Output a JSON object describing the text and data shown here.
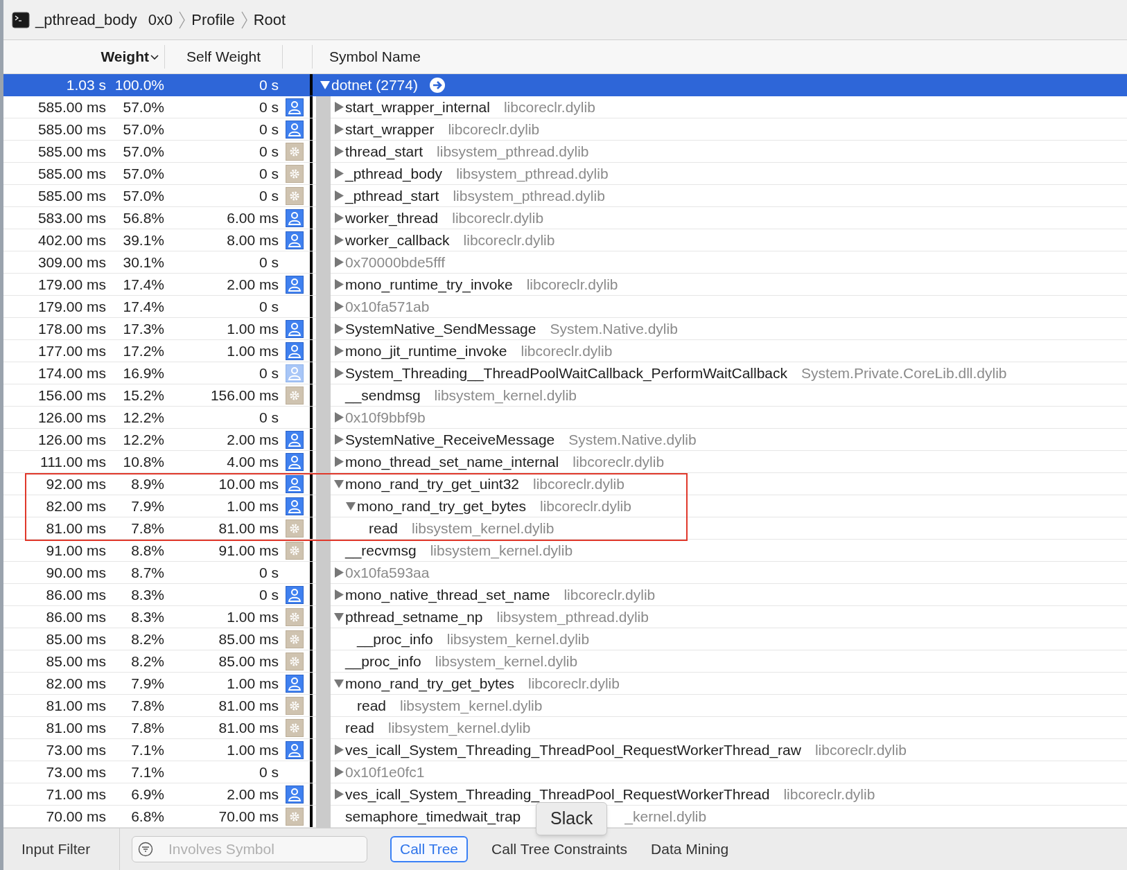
{
  "breadcrumb": [
    {
      "label": "_pthread_body",
      "detail": "0x0"
    },
    {
      "label": "Profile"
    },
    {
      "label": "Root"
    }
  ],
  "columns": [
    {
      "label": "Weight",
      "sorted": true
    },
    {
      "label": "Self Weight",
      "sorted": false
    },
    {
      "label": "Symbol Name",
      "sorted": false
    }
  ],
  "tree": [
    {
      "weight": "1.03 s",
      "percent": "100.0%",
      "self_weight": "0 s",
      "name": "dotnet (2774)",
      "kind": "process",
      "expanded": true,
      "selected": true,
      "children": [
        {
          "weight": "585.00 ms",
          "percent": "57.0%",
          "self_weight": "0 s",
          "name": "start_wrapper_internal",
          "library": "libcoreclr.dylib",
          "kind": "user",
          "expanded": false,
          "selected": false
        },
        {
          "weight": "585.00 ms",
          "percent": "57.0%",
          "self_weight": "0 s",
          "name": "start_wrapper",
          "library": "libcoreclr.dylib",
          "kind": "user",
          "expanded": false,
          "selected": false
        },
        {
          "weight": "585.00 ms",
          "percent": "57.0%",
          "self_weight": "0 s",
          "name": "thread_start",
          "library": "libsystem_pthread.dylib",
          "kind": "system",
          "expanded": false,
          "selected": false
        },
        {
          "weight": "585.00 ms",
          "percent": "57.0%",
          "self_weight": "0 s",
          "name": "_pthread_body",
          "library": "libsystem_pthread.dylib",
          "kind": "system",
          "expanded": false,
          "selected": false
        },
        {
          "weight": "585.00 ms",
          "percent": "57.0%",
          "self_weight": "0 s",
          "name": "_pthread_start",
          "library": "libsystem_pthread.dylib",
          "kind": "system",
          "expanded": false,
          "selected": false
        },
        {
          "weight": "583.00 ms",
          "percent": "56.8%",
          "self_weight": "6.00 ms",
          "name": "worker_thread",
          "library": "libcoreclr.dylib",
          "kind": "user",
          "expanded": false,
          "selected": false
        },
        {
          "weight": "402.00 ms",
          "percent": "39.1%",
          "self_weight": "8.00 ms",
          "name": "worker_callback",
          "library": "libcoreclr.dylib",
          "kind": "user",
          "expanded": false,
          "selected": false
        },
        {
          "weight": "309.00 ms",
          "percent": "30.1%",
          "self_weight": "0 s",
          "name": "0x70000bde5fff",
          "kind": "address",
          "expanded": false,
          "selected": false
        },
        {
          "weight": "179.00 ms",
          "percent": "17.4%",
          "self_weight": "2.00 ms",
          "name": "mono_runtime_try_invoke",
          "library": "libcoreclr.dylib",
          "kind": "user",
          "expanded": false,
          "selected": false
        },
        {
          "weight": "179.00 ms",
          "percent": "17.4%",
          "self_weight": "0 s",
          "name": "0x10fa571ab",
          "kind": "address",
          "expanded": false,
          "selected": false
        },
        {
          "weight": "178.00 ms",
          "percent": "17.3%",
          "self_weight": "1.00 ms",
          "name": "SystemNative_SendMessage",
          "library": "System.Native.dylib",
          "kind": "user",
          "expanded": false,
          "selected": false
        },
        {
          "weight": "177.00 ms",
          "percent": "17.2%",
          "self_weight": "1.00 ms",
          "name": "mono_jit_runtime_invoke",
          "library": "libcoreclr.dylib",
          "kind": "user",
          "expanded": false,
          "selected": false
        },
        {
          "weight": "174.00 ms",
          "percent": "16.9%",
          "self_weight": "0 s",
          "name": "System_Threading__ThreadPoolWaitCallback_PerformWaitCallback",
          "library": "System.Private.CoreLib.dll.dylib",
          "kind": "user_dim",
          "expanded": false,
          "selected": false
        },
        {
          "weight": "156.00 ms",
          "percent": "15.2%",
          "self_weight": "156.00 ms",
          "name": "__sendmsg",
          "library": "libsystem_kernel.dylib",
          "kind": "system",
          "selected": false
        },
        {
          "weight": "126.00 ms",
          "percent": "12.2%",
          "self_weight": "0 s",
          "name": "0x10f9bbf9b",
          "kind": "address",
          "expanded": false,
          "selected": false
        },
        {
          "weight": "126.00 ms",
          "percent": "12.2%",
          "self_weight": "2.00 ms",
          "name": "SystemNative_ReceiveMessage",
          "library": "System.Native.dylib",
          "kind": "user",
          "expanded": false,
          "selected": false
        },
        {
          "weight": "111.00 ms",
          "percent": "10.8%",
          "self_weight": "4.00 ms",
          "name": "mono_thread_set_name_internal",
          "library": "libcoreclr.dylib",
          "kind": "user",
          "expanded": false,
          "selected": false
        },
        {
          "weight": "92.00 ms",
          "percent": "8.9%",
          "self_weight": "10.00 ms",
          "name": "mono_rand_try_get_uint32",
          "library": "libcoreclr.dylib",
          "kind": "user",
          "expanded": true,
          "selected": false,
          "boxed": true,
          "children": [
            {
              "weight": "82.00 ms",
              "percent": "7.9%",
              "self_weight": "1.00 ms",
              "name": "mono_rand_try_get_bytes",
              "library": "libcoreclr.dylib",
              "kind": "user",
              "expanded": true,
              "selected": false,
              "boxed": true,
              "children": [
                {
                  "weight": "81.00 ms",
                  "percent": "7.8%",
                  "self_weight": "81.00 ms",
                  "name": "read",
                  "library": "libsystem_kernel.dylib",
                  "kind": "system",
                  "selected": false,
                  "boxed": true
                }
              ]
            }
          ]
        },
        {
          "weight": "91.00 ms",
          "percent": "8.8%",
          "self_weight": "91.00 ms",
          "name": "__recvmsg",
          "library": "libsystem_kernel.dylib",
          "kind": "system",
          "selected": false
        },
        {
          "weight": "90.00 ms",
          "percent": "8.7%",
          "self_weight": "0 s",
          "name": "0x10fa593aa",
          "kind": "address",
          "expanded": false,
          "selected": false
        },
        {
          "weight": "86.00 ms",
          "percent": "8.3%",
          "self_weight": "0 s",
          "name": "mono_native_thread_set_name",
          "library": "libcoreclr.dylib",
          "kind": "user",
          "expanded": false,
          "selected": false
        },
        {
          "weight": "86.00 ms",
          "percent": "8.3%",
          "self_weight": "1.00 ms",
          "name": "pthread_setname_np",
          "library": "libsystem_pthread.dylib",
          "kind": "system",
          "expanded": true,
          "selected": false,
          "children": [
            {
              "weight": "85.00 ms",
              "percent": "8.2%",
              "self_weight": "85.00 ms",
              "name": "__proc_info",
              "library": "libsystem_kernel.dylib",
              "kind": "system",
              "selected": false
            }
          ]
        },
        {
          "weight": "85.00 ms",
          "percent": "8.2%",
          "self_weight": "85.00 ms",
          "name": "__proc_info",
          "library": "libsystem_kernel.dylib",
          "kind": "system",
          "selected": false
        },
        {
          "weight": "82.00 ms",
          "percent": "7.9%",
          "self_weight": "1.00 ms",
          "name": "mono_rand_try_get_bytes",
          "library": "libcoreclr.dylib",
          "kind": "user",
          "expanded": true,
          "selected": false,
          "children": [
            {
              "weight": "81.00 ms",
              "percent": "7.8%",
              "self_weight": "81.00 ms",
              "name": "read",
              "library": "libsystem_kernel.dylib",
              "kind": "system",
              "selected": false
            }
          ]
        },
        {
          "weight": "81.00 ms",
          "percent": "7.8%",
          "self_weight": "81.00 ms",
          "name": "read",
          "library": "libsystem_kernel.dylib",
          "kind": "system",
          "selected": false
        },
        {
          "weight": "73.00 ms",
          "percent": "7.1%",
          "self_weight": "1.00 ms",
          "name": "ves_icall_System_Threading_ThreadPool_RequestWorkerThread_raw",
          "library": "libcoreclr.dylib",
          "kind": "user",
          "expanded": false,
          "selected": false
        },
        {
          "weight": "73.00 ms",
          "percent": "7.1%",
          "self_weight": "0 s",
          "name": "0x10f1e0fc1",
          "kind": "address",
          "expanded": false,
          "selected": false
        },
        {
          "weight": "71.00 ms",
          "percent": "6.9%",
          "self_weight": "2.00 ms",
          "name": "ves_icall_System_Threading_ThreadPool_RequestWorkerThread",
          "library": "libcoreclr.dylib",
          "kind": "user",
          "expanded": false,
          "selected": false
        },
        {
          "weight": "70.00 ms",
          "percent": "6.8%",
          "self_weight": "70.00 ms",
          "name": "semaphore_timedwait_trap",
          "library": "_kernel.dylib",
          "kind": "system",
          "selected": false,
          "covered": true
        }
      ]
    }
  ],
  "bottom_bar": {
    "label": "Input Filter",
    "search": {
      "placeholder": "Involves Symbol"
    },
    "tabs": [
      {
        "label": "Call Tree",
        "selected": true
      },
      {
        "label": "Call Tree Constraints",
        "selected": false
      },
      {
        "label": "Data Mining",
        "selected": false
      }
    ]
  },
  "tooltip": {
    "text": "Slack"
  }
}
